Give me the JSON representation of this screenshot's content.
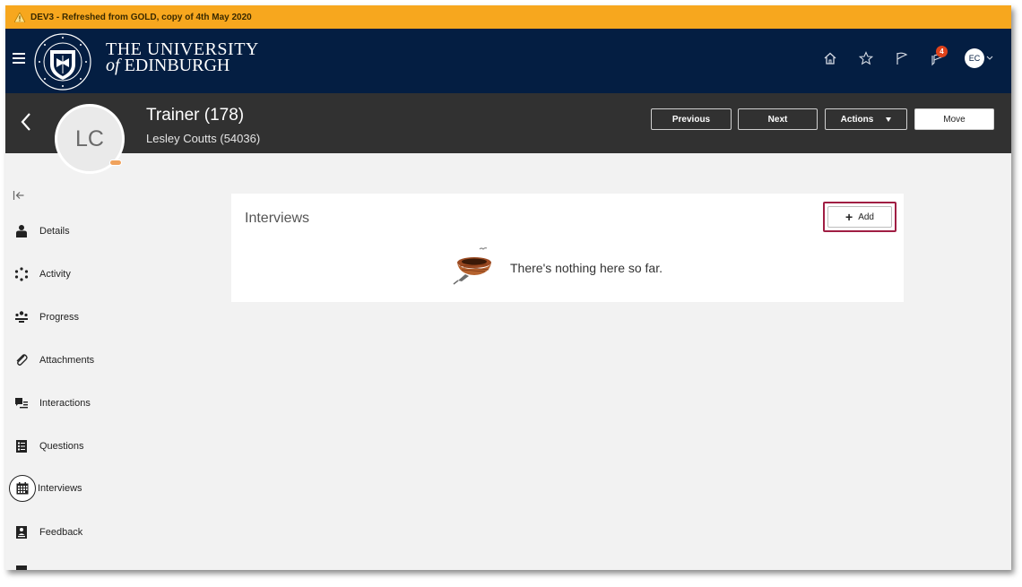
{
  "env_banner": {
    "text": "DEV3 - Refreshed from GOLD, copy of 4th May 2020",
    "icon": "warning-icon"
  },
  "header": {
    "brand_line1": "THE UNIVERSITY",
    "brand_of": "of",
    "brand_line2": "EDINBURGH",
    "icons": [
      "menu-icon",
      "home-icon",
      "star-icon",
      "flag-icon",
      "notifications-icon"
    ],
    "notification_count": "4",
    "user_initials": "EC",
    "colors": {
      "banner": "#f7a71e",
      "header": "#041e42",
      "record_bar": "#313131"
    }
  },
  "record": {
    "title": "Trainer (178)",
    "subtitle": "Lesley Coutts (54036)",
    "avatar_initials": "LC",
    "buttons": {
      "previous": "Previous",
      "next": "Next",
      "actions": "Actions",
      "move": "Move"
    }
  },
  "sidebar": {
    "items": [
      {
        "label": "Details",
        "icon": "person-icon"
      },
      {
        "label": "Activity",
        "icon": "activity-icon"
      },
      {
        "label": "Progress",
        "icon": "progress-icon"
      },
      {
        "label": "Attachments",
        "icon": "paperclip-icon"
      },
      {
        "label": "Interactions",
        "icon": "interactions-icon"
      },
      {
        "label": "Questions",
        "icon": "questions-icon"
      },
      {
        "label": "Interviews",
        "icon": "calendar-icon",
        "active": true
      },
      {
        "label": "Feedback",
        "icon": "feedback-icon"
      }
    ]
  },
  "main": {
    "section_title": "Interviews",
    "add_label": "Add",
    "empty_message": "There's nothing here so far.",
    "accent_focus": "#a01e43"
  }
}
